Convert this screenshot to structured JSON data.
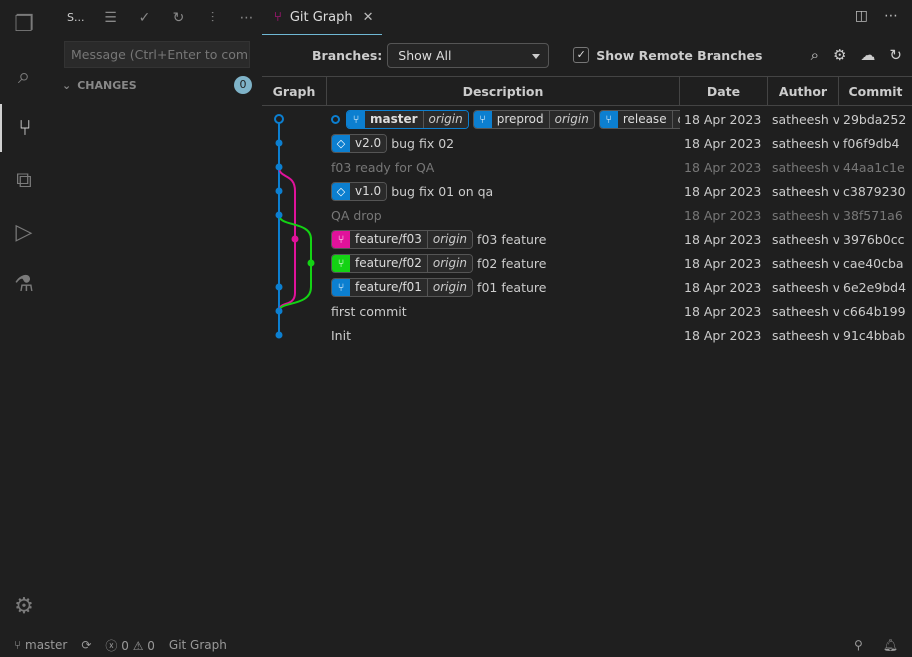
{
  "activity": [
    "files-icon",
    "search-icon",
    "source-control-icon",
    "extensions-icon",
    "run-debug-icon",
    "git-graph-icon"
  ],
  "sidebar": {
    "title": "S...",
    "message_placeholder": "Message (Ctrl+Enter to com…",
    "changes_label": "CHANGES",
    "changes_count": "0"
  },
  "tab": {
    "label": "Git Graph",
    "close": "✕"
  },
  "controls": {
    "branches_label": "Branches:",
    "branches_value": "Show All",
    "show_remote_label": "Show Remote Branches",
    "show_remote_checked": true
  },
  "columns": [
    "Graph",
    "Description",
    "Date",
    "Author",
    "Commit"
  ],
  "colors": {
    "master": "#0c7fd0",
    "f03": "#e0129b",
    "f02": "#14d314"
  },
  "commits": [
    {
      "refs": [
        {
          "name": "master",
          "remote": "origin",
          "color": "#0c7fd0",
          "head": true
        },
        {
          "name": "preprod",
          "remote": "origin",
          "color": "#0c7fd0"
        },
        {
          "name": "release",
          "remote": "origin",
          "color": "#0c7fd0"
        }
      ],
      "message": "",
      "date": "18 Apr 2023",
      "author": "satheesh v",
      "hash": "29bda252"
    },
    {
      "tags": [
        "v2.0"
      ],
      "message": "bug fix 02",
      "date": "18 Apr 2023",
      "author": "satheesh v",
      "hash": "f06f9db4"
    },
    {
      "message": "f03 ready for QA",
      "date": "18 Apr 2023",
      "author": "satheesh v",
      "hash": "44aa1c1e",
      "dim": true
    },
    {
      "tags": [
        "v1.0"
      ],
      "message": "bug fix 01 on qa",
      "date": "18 Apr 2023",
      "author": "satheesh v",
      "hash": "c3879230"
    },
    {
      "message": "QA drop",
      "date": "18 Apr 2023",
      "author": "satheesh v",
      "hash": "38f571a6",
      "dim": true
    },
    {
      "refs": [
        {
          "name": "feature/f03",
          "remote": "origin",
          "color": "#e0129b"
        }
      ],
      "message": "f03 feature",
      "date": "18 Apr 2023",
      "author": "satheesh v",
      "hash": "3976b0cc"
    },
    {
      "refs": [
        {
          "name": "feature/f02",
          "remote": "origin",
          "color": "#14d314"
        }
      ],
      "message": "f02 feature",
      "date": "18 Apr 2023",
      "author": "satheesh v",
      "hash": "cae40cba"
    },
    {
      "refs": [
        {
          "name": "feature/f01",
          "remote": "origin",
          "color": "#0c7fd0"
        }
      ],
      "message": "f01 feature",
      "date": "18 Apr 2023",
      "author": "satheesh v",
      "hash": "6e2e9bd4"
    },
    {
      "message": "first commit",
      "date": "18 Apr 2023",
      "author": "satheesh v",
      "hash": "c664b199"
    },
    {
      "message": "Init",
      "date": "18 Apr 2023",
      "author": "satheesh v",
      "hash": "91c4bbab"
    }
  ],
  "status": {
    "branch": "master",
    "errors": "0",
    "warnings": "0",
    "extension": "Git Graph"
  }
}
